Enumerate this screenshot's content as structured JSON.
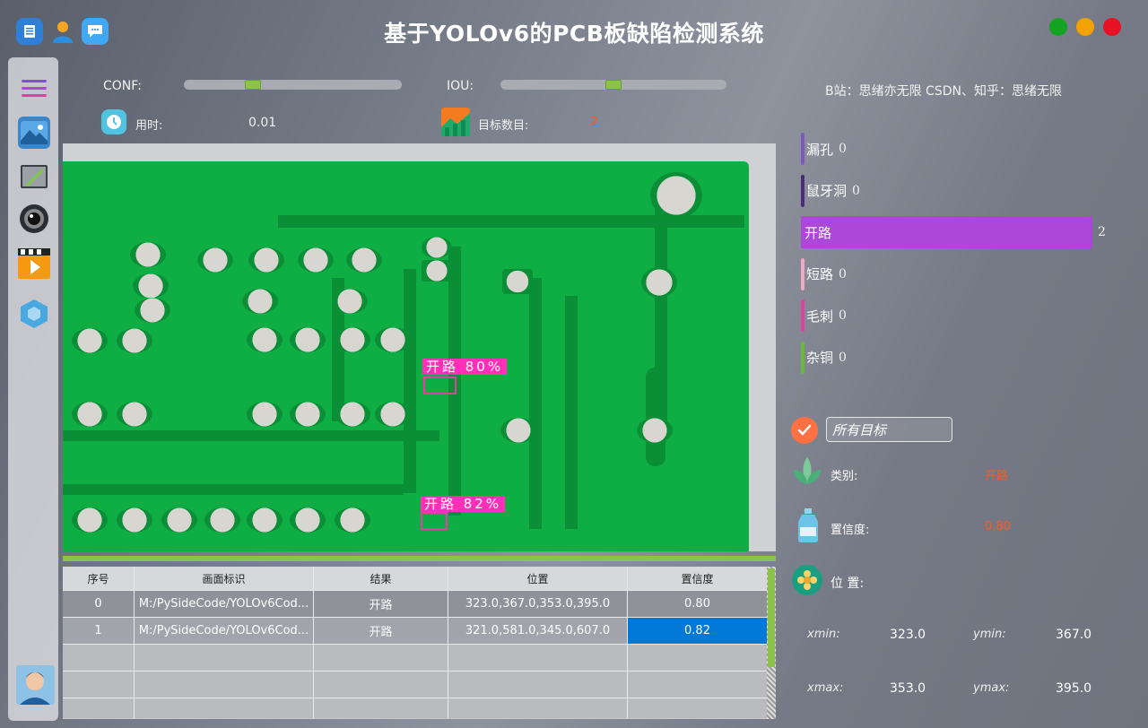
{
  "window": {
    "title": "基于YOLOv6的PCB板缺陷检测系统",
    "colors": {
      "close": "#e81123",
      "minimize": "#f4a200",
      "maximize": "#14a323"
    }
  },
  "titlebar_icons": [
    "document-icon",
    "user-icon",
    "chat-icon"
  ],
  "sidebar": {
    "items": [
      {
        "icon": "menu-icon"
      },
      {
        "icon": "image-icon"
      },
      {
        "icon": "folder-icon"
      },
      {
        "icon": "camera-icon"
      },
      {
        "icon": "video-icon"
      },
      {
        "icon": "model-cube-icon"
      }
    ],
    "avatar": "avatar"
  },
  "controls": {
    "conf_label": "CONF:",
    "conf_value": 0.3,
    "iou_label": "IOU:",
    "iou_value": 0.5,
    "time_label": "用时:",
    "time_value": "0.01",
    "count_label": "目标数目:",
    "count_value": "2",
    "credit": "B站：思绪亦无限  CSDN、知乎：思绪无限"
  },
  "detections": [
    {
      "label": "开路  80%"
    },
    {
      "label": "开路  82%"
    }
  ],
  "table": {
    "headers": [
      "序号",
      "画面标识",
      "结果",
      "位置",
      "置信度"
    ],
    "rows": [
      [
        "0",
        "M:/PySideCode/YOLOv6Cod...",
        "开路",
        "323.0,367.0,353.0,395.0",
        "0.80"
      ],
      [
        "1",
        "M:/PySideCode/YOLOv6Cod...",
        "开路",
        "321.0,581.0,345.0,607.0",
        "0.82"
      ]
    ]
  },
  "classes": [
    {
      "name": "漏孔",
      "count": "0",
      "value": 0,
      "color": "#7e57c2"
    },
    {
      "name": "鼠牙洞",
      "count": "0",
      "value": 0,
      "color": "#4a2c7a"
    },
    {
      "name": "开路",
      "count": "2",
      "value": 2,
      "color": "#ab47d9"
    },
    {
      "name": "短路",
      "count": "0",
      "value": 0,
      "color": "#f4a7c0"
    },
    {
      "name": "毛刺",
      "count": "0",
      "value": 0,
      "color": "#e040a0"
    },
    {
      "name": "杂铜",
      "count": "0",
      "value": 0,
      "color": "#66bb33"
    }
  ],
  "detail": {
    "target_select": "所有目标",
    "class_label": "类别:",
    "class_value": "开路",
    "conf_label": "置信度:",
    "conf_value": "0.80",
    "pos_label": "位 置:",
    "xmin_label": "xmin:",
    "xmin_value": "323.0",
    "ymin_label": "ymin:",
    "ymin_value": "367.0",
    "xmax_label": "xmax:",
    "xmax_value": "353.0",
    "ymax_label": "ymax:",
    "ymax_value": "395.0"
  }
}
